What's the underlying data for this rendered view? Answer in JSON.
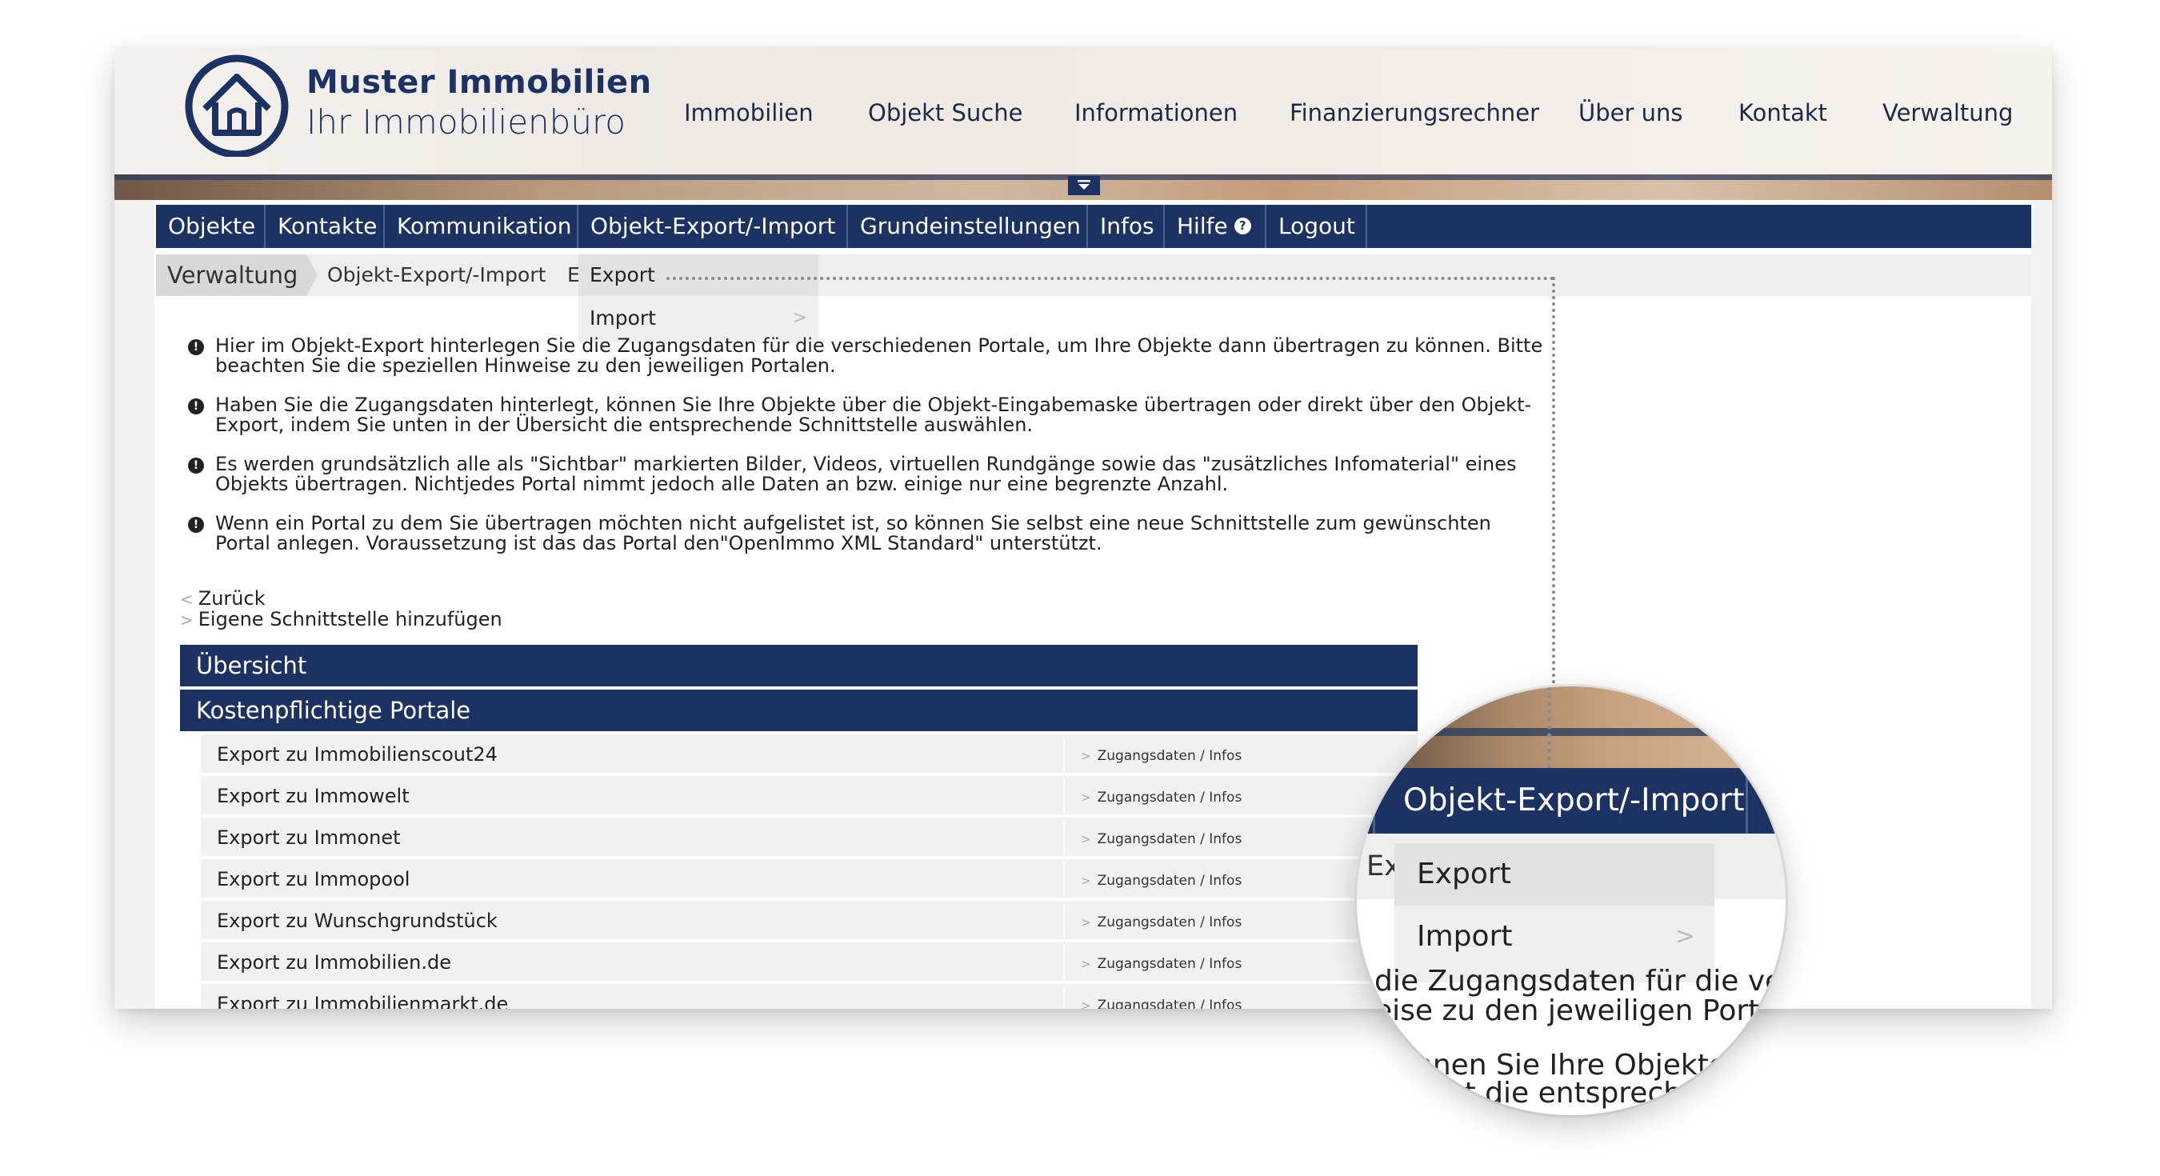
{
  "brand": {
    "name": "Muster Immobilien",
    "tagline": "Ihr Immobilienbüro"
  },
  "main_nav": [
    "Immobilien",
    "Objekt Suche",
    "Informationen",
    "Finanzierungsrechner",
    "Über uns",
    "Kontakt",
    "Verwaltung"
  ],
  "tabs": [
    "Objekte",
    "Kontakte",
    "Kommunikation",
    "Objekt-Export/-Import",
    "Grundeinstellungen",
    "Infos",
    "Hilfe",
    "Logout"
  ],
  "help_icon": "?",
  "breadcrumb": {
    "root": "Verwaltung",
    "section": "Objekt-Export/-Import",
    "current": "Ex"
  },
  "dropdown": {
    "items": [
      "Export",
      "Import"
    ],
    "chevron": ">"
  },
  "info_icon": "!",
  "info_items": [
    "Hier im Objekt-Export hinterlegen Sie die Zugangsdaten für die verschiedenen Portale, um Ihre Objekte dann übertragen zu können. Bitte beachten Sie die speziellen Hinweise zu den jeweiligen Portalen.",
    "Haben Sie die Zugangsdaten hinterlegt, können Sie Ihre Objekte über die Objekt-Eingabemaske übertragen oder direkt über den Objekt-Export, indem Sie unten in der Übersicht die entsprechende Schnittstelle auswählen.",
    "Es werden grundsätzlich alle als \"Sichtbar\" markierten Bilder, Videos, virtuellen Rundgänge sowie das \"zusätzliches Infomaterial\" eines Objekts übertragen. Nichtjedes Portal nimmt jedoch alle Daten an bzw. einige nur eine begrenzte Anzahl.",
    "Wenn ein Portal zu dem Sie übertragen möchten nicht aufgelistet ist, so können Sie selbst eine neue Schnittstelle zum gewünschten Portal anlegen. Voraussetzung ist das das Portal den\"OpenImmo XML Standard\" unterstützt."
  ],
  "links": {
    "back": "Zurück",
    "add_interface": "Eigene Schnittstelle hinzufügen",
    "back_chevron": "<",
    "add_chevron": ">"
  },
  "sections": {
    "overview": "Übersicht",
    "paid_portals": "Kostenpflichtige Portale"
  },
  "portals": [
    {
      "name": "Export zu Immobilienscout24",
      "link": "Zugangsdaten / Infos"
    },
    {
      "name": "Export zu Immowelt",
      "link": "Zugangsdaten / Infos"
    },
    {
      "name": "Export zu Immonet",
      "link": "Zugangsdaten / Infos"
    },
    {
      "name": "Export zu Immopool",
      "link": "Zugangsdaten / Infos"
    },
    {
      "name": "Export zu Wunschgrundstück",
      "link": "Zugangsdaten / Infos"
    },
    {
      "name": "Export zu Immobilien.de",
      "link": "Zugangsdaten / Infos"
    },
    {
      "name": "Export zu Immobilienmarkt.de",
      "link": "Zugangsdaten / Infos"
    }
  ],
  "magnifier": {
    "tab_label": "Objekt-Export/-Import",
    "bc_fragment": "Ex",
    "items": [
      "Export",
      "Import"
    ],
    "chevron": ">",
    "text_lines": [
      "die Zugangsdaten für die verschi",
      "eise zu den jeweiligen Portalen.",
      "nnen Sie Ihre Objekte ü",
      "cht die entspreche"
    ]
  },
  "colors": {
    "navy": "#1b3262",
    "background": "#f2f2f2",
    "row": "#f1f1f1"
  }
}
